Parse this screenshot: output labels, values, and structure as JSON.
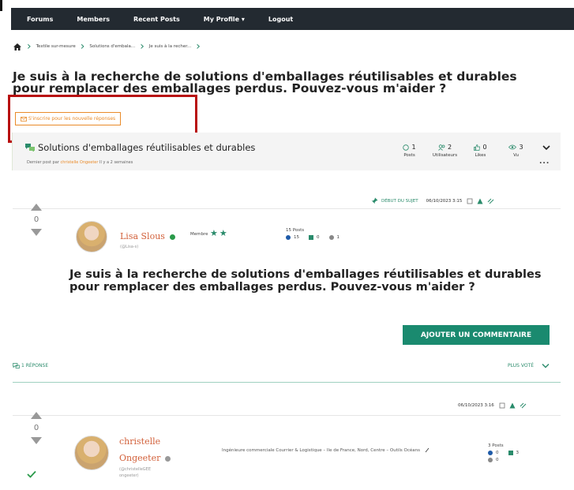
{
  "nav": {
    "items": [
      "Forums",
      "Members",
      "Recent Posts",
      "My Profile ▾",
      "Logout"
    ]
  },
  "breadcrumb": [
    "Textile sur-mesure",
    "Solutions d'embala...",
    "Je suis à la recher..."
  ],
  "title": "Je suis à la recherche de solutions d'emballages réutilisables et durables pour remplacer des emballages perdus. Pouvez-vous m'aider ?",
  "subscribe_label": "S'inscrire pour les nouvelle réponses",
  "topic": {
    "title": "Solutions d'emballages réutilisables et durables",
    "last_prefix": "Dernier post par",
    "last_author": "christelle Ongeeter",
    "last_suffix": "Il y a 2 semaines",
    "stats": [
      {
        "value": "1",
        "label": "Posts"
      },
      {
        "value": "2",
        "label": "Utilisateurs"
      },
      {
        "value": "0",
        "label": "Likes"
      },
      {
        "value": "3",
        "label": "Vu"
      }
    ],
    "more": "..."
  },
  "first_post": {
    "badge": "DÉBUT DU SUJET",
    "datetime": "06/10/2023 3:15",
    "votes": "0",
    "author": "Lisa Slous",
    "role": "(@Lisa-s)",
    "member_label": "Membre",
    "stars": "★★",
    "posts_label": "15 Posts",
    "count_a": "15",
    "count_b": "0",
    "count_c": "1",
    "body": "Je suis à la recherche de solutions d'emballages réutilisables et durables pour remplacer des emballages perdus. Pouvez-vous m'aider ?"
  },
  "add_comment_label": "AJOUTER UN COMMENTAIRE",
  "replies_label": "1 RÉPONSE",
  "sort_label": "PLUS VOTÉ",
  "reply": {
    "datetime": "06/10/2023 3:16",
    "votes": "0",
    "author_line1": "christelle",
    "author_line2": "Ongeeter",
    "role_line1": "(@christelleGEE",
    "role_line2": "ongeeter)",
    "description": "Ingénieure commerciale Courrier & Logistique – Ile de France, Nord, Centre – Outils Océans",
    "posts_label": "3 Posts",
    "count_a": "0",
    "count_b": "3",
    "count_c": "0"
  },
  "colors": {
    "accent_green": "#1a8a6f",
    "accent_orange": "#e98b2a",
    "highlight_red": "#b80e0e",
    "nav_bg": "#232a31"
  }
}
